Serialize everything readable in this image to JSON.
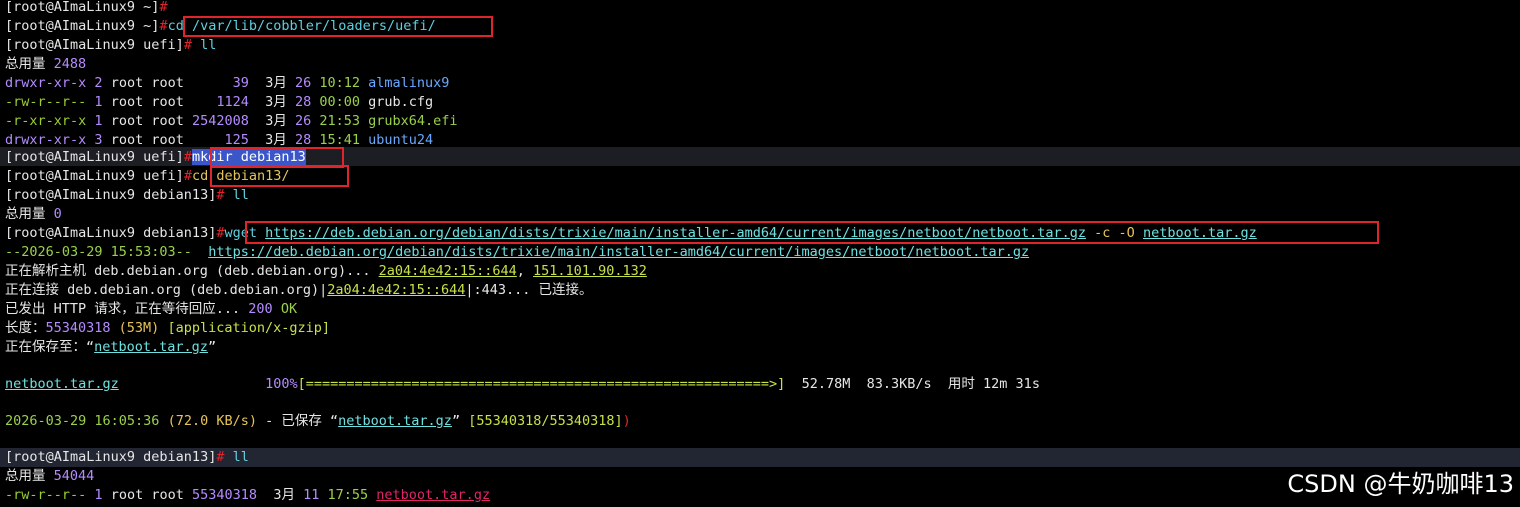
{
  "prompt_home": "[root@AImaLinux9 ~]",
  "prompt_uefi": "[root@AImaLinux9 uefi]",
  "prompt_deb": "[root@AImaLinux9 debian13]",
  "hash": "#",
  "cmd_cd_uefi": "cd /var/lib/cobbler/loaders/uefi/",
  "cmd_ll": "ll",
  "total1_label": "总用量",
  "total1_value": "2488",
  "ls1": [
    {
      "perm": "drwxr-xr-x",
      "links": "2",
      "owner": "root",
      "group": "root",
      "size": "39",
      "month": "3月",
      "day": "26",
      "time": "10:12",
      "name": "almalinux9"
    },
    {
      "perm": "-rw-r--r--",
      "links": "1",
      "owner": "root",
      "group": "root",
      "size": "1124",
      "month": "3月",
      "day": "28",
      "time": "00:00",
      "name": "grub.cfg"
    },
    {
      "perm": "-r-xr-xr-x",
      "links": "1",
      "owner": "root",
      "group": "root",
      "size": "2542008",
      "month": "3月",
      "day": "26",
      "time": "21:53",
      "name": "grubx64.efi"
    },
    {
      "perm": "drwxr-xr-x",
      "links": "3",
      "owner": "root",
      "group": "root",
      "size": "125",
      "month": "3月",
      "day": "28",
      "time": "15:41",
      "name": "ubuntu24"
    }
  ],
  "cmd_mkdir": "mkdir debian13",
  "cmd_cd_deb": "cd debian13/",
  "total2_label": "总用量",
  "total2_value": "0",
  "wget_cmd": "wget",
  "wget_url": "https://deb.debian.org/debian/dists/trixie/main/installer-amd64/current/images/netboot/netboot.tar.gz",
  "wget_flags": "-c -O",
  "wget_outfile": "netboot.tar.gz",
  "wget_start_time": "--2026-03-29 15:53:03--",
  "resolve_prefix": "正在解析主机 deb.debian.org (deb.debian.org)... ",
  "ip6": "2a04:4e42:15::644",
  "ip4": "151.101.90.132",
  "connect_prefix": "正在连接 deb.debian.org (deb.debian.org)|",
  "connect_ip": "2a04:4e42:15::644",
  "connect_suffix": "|:443... 已连接。",
  "http_prefix": "已发出 HTTP 请求，正在等待回应... ",
  "http_code": "200",
  "http_ok": "OK",
  "length_prefix": "长度：",
  "length_value": "55340318",
  "length_human": "(53M)",
  "length_type": "[application/x-gzip]",
  "saving_prefix": "正在保存至：",
  "saving_file": "netboot.tar.gz",
  "progress_file": "netboot.tar.gz",
  "progress_percent": "100%",
  "progress_bar": "[=========================================================>]",
  "progress_size": "52.78M",
  "progress_rate": "83.3KB/s",
  "progress_time_label": "用时",
  "progress_time": "12m 31s",
  "done_time": "2026-03-29 16:05:36",
  "done_rate": "(72.0 KB/s)",
  "done_mid": " - 已保存 ",
  "done_file": "netboot.tar.gz",
  "done_bytes": "[55340318/55340318]",
  "total3_label": "总用量",
  "total3_value": "54044",
  "ls3": {
    "perm": "-rw-r--r--",
    "links": "1",
    "owner": "root",
    "group": "root",
    "size": "55340318",
    "month": "3月",
    "day": "11",
    "time": "17:55",
    "name": "netboot.tar.gz"
  },
  "watermark": "CSDN @牛奶咖啡13"
}
